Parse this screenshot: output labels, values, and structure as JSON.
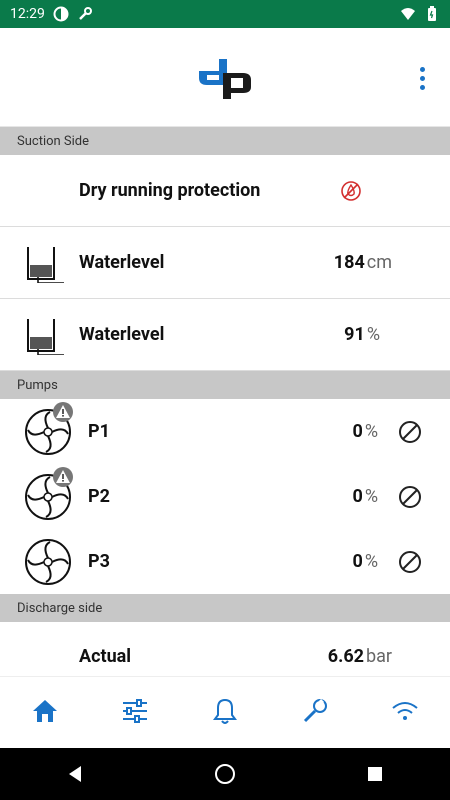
{
  "status": {
    "time": "12:29"
  },
  "sections": {
    "suction": "Suction Side",
    "pumps": "Pumps",
    "discharge": "Discharge side"
  },
  "suction_rows": {
    "dry_running": {
      "label": "Dry running protection"
    },
    "waterlevel_cm": {
      "label": "Waterlevel",
      "value": "184",
      "unit": "cm"
    },
    "waterlevel_pct": {
      "label": "Waterlevel",
      "value": "91",
      "unit": "%"
    }
  },
  "pumps": [
    {
      "name": "P1",
      "value": "0",
      "unit": "%"
    },
    {
      "name": "P2",
      "value": "0",
      "unit": "%"
    },
    {
      "name": "P3",
      "value": "0",
      "unit": "%"
    }
  ],
  "discharge_rows": {
    "actual": {
      "label": "Actual",
      "value": "6.62",
      "unit": "bar"
    }
  },
  "colors": {
    "status_bar": "#0a7a4a",
    "accent": "#1a73c7",
    "section_bg": "#c7c7c7",
    "alert": "#d32f2f"
  },
  "nav": {
    "items": [
      "home-icon",
      "sliders-icon",
      "bell-icon",
      "wrench-icon",
      "wifi-icon"
    ]
  }
}
